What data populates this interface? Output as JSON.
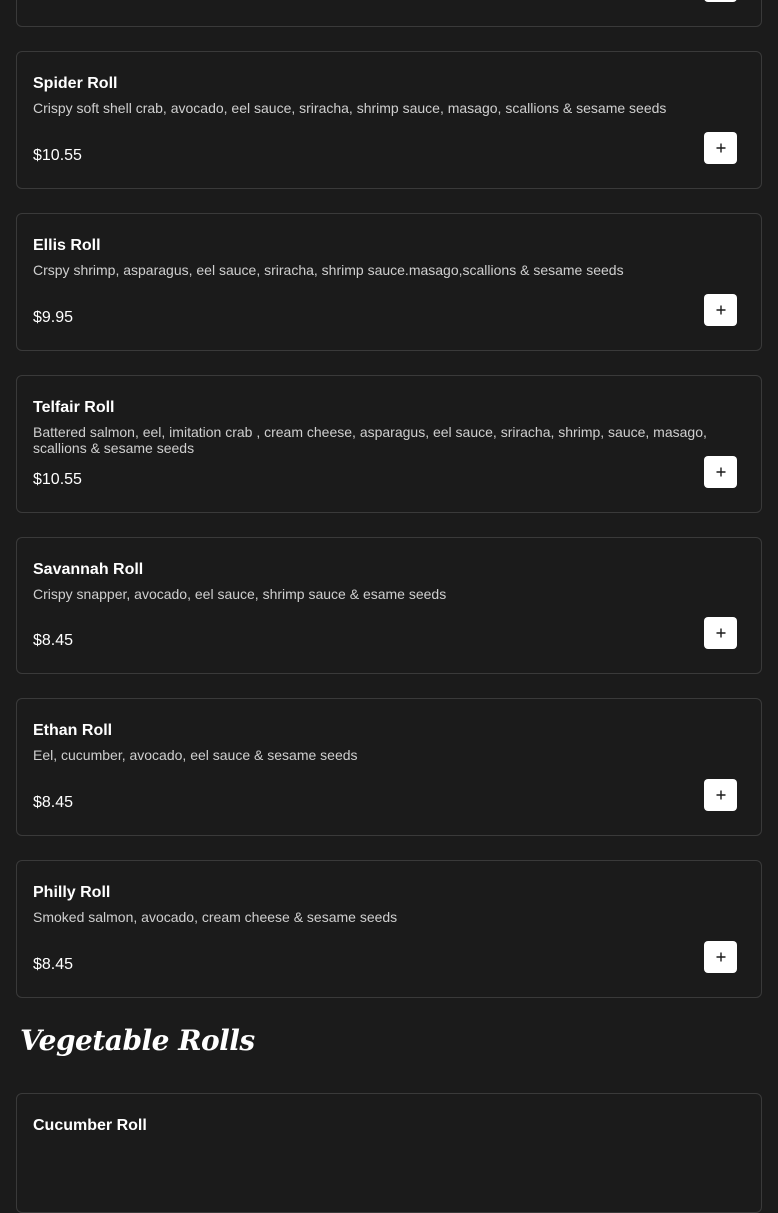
{
  "menu": {
    "items": [
      {
        "name": "",
        "description": "",
        "price": ""
      },
      {
        "name": "Spider Roll",
        "description": "Crispy soft shell crab, avocado, eel sauce, sriracha, shrimp sauce, masago, scallions & sesame seeds",
        "price": "$10.55"
      },
      {
        "name": "Ellis Roll",
        "description": "Crspy shrimp, asparagus, eel sauce, sriracha, shrimp sauce.masago,scallions & sesame seeds",
        "price": "$9.95"
      },
      {
        "name": "Telfair Roll",
        "description": "Battered salmon, eel, imitation crab , cream cheese, asparagus, eel sauce, sriracha, shrimp, sauce, masago, scallions & sesame seeds",
        "price": "$10.55"
      },
      {
        "name": "Savannah Roll",
        "description": "Crispy snapper, avocado, eel sauce, shrimp sauce & esame seeds",
        "price": "$8.45"
      },
      {
        "name": "Ethan Roll",
        "description": "Eel, cucumber, avocado, eel sauce & sesame seeds",
        "price": "$8.45"
      },
      {
        "name": "Philly Roll",
        "description": "Smoked salmon, avocado, cream cheese & sesame seeds",
        "price": "$8.45"
      }
    ],
    "add_icon": "plus-icon"
  },
  "section": {
    "title": "Vegetable Rolls",
    "items": [
      {
        "name": "Cucumber Roll"
      }
    ]
  }
}
